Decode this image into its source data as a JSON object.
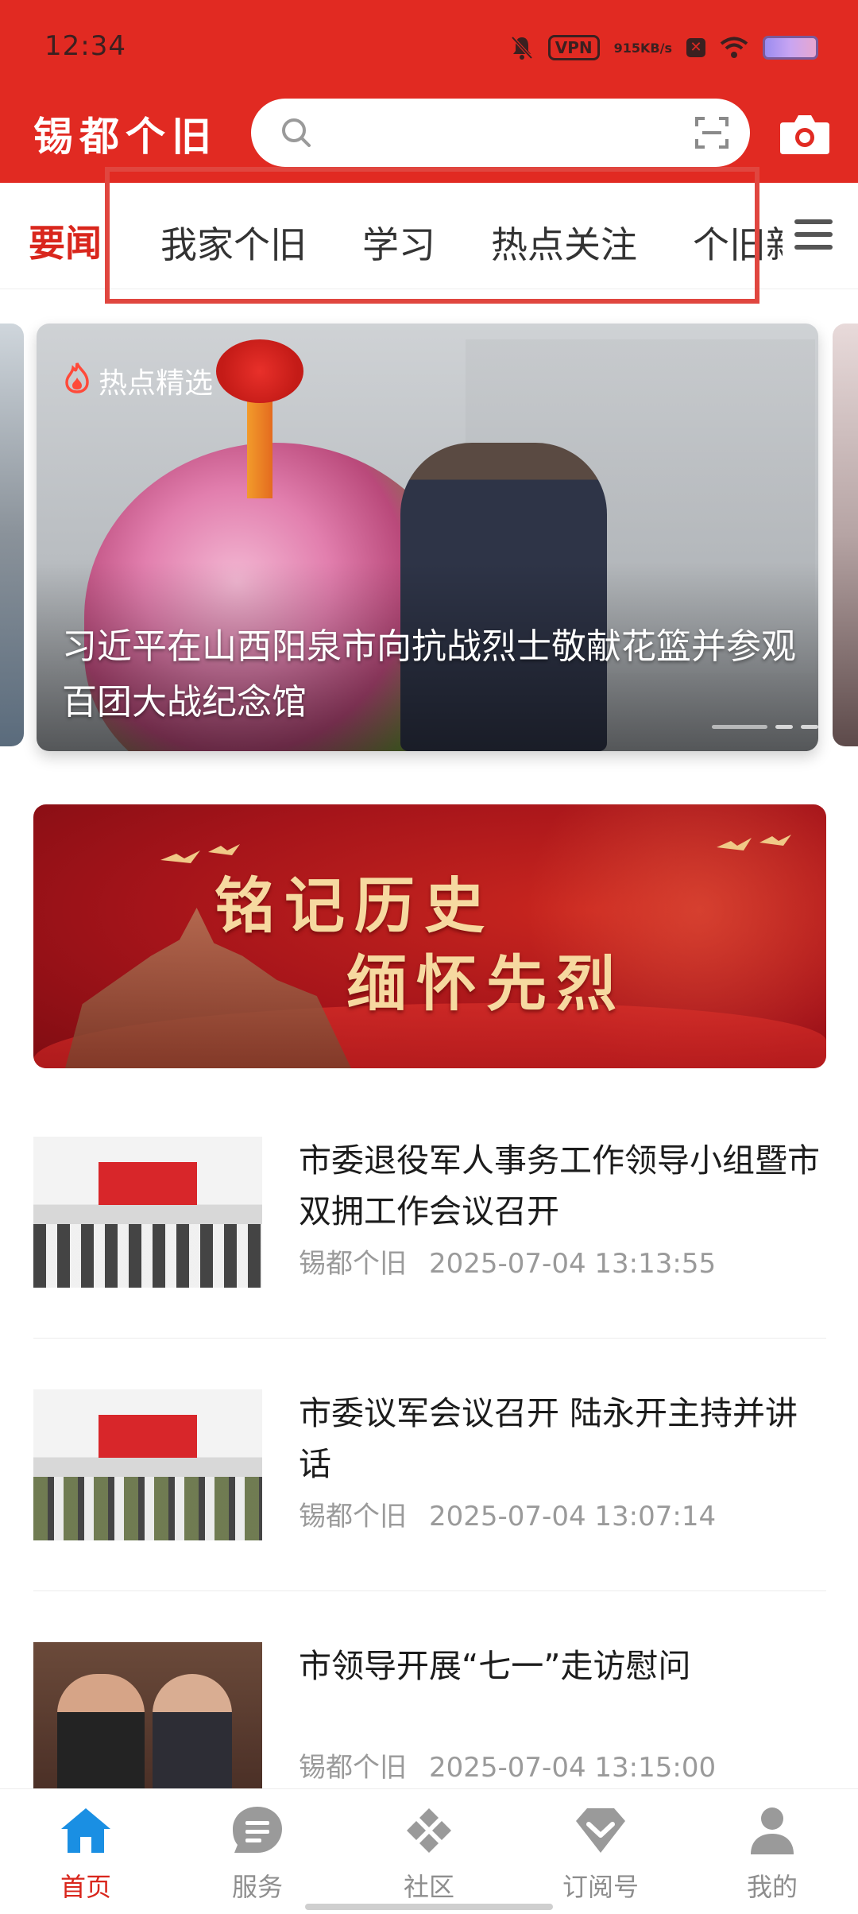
{
  "status_bar": {
    "time": "12:34",
    "vpn_label": "VPN",
    "speed_value": "915",
    "speed_unit": "KB/s"
  },
  "header": {
    "logo": "锡都个旧",
    "search": {
      "placeholder": ""
    }
  },
  "tabs": {
    "active": "要闻",
    "items": [
      "我家个旧",
      "学习",
      "热点关注",
      "个旧新"
    ]
  },
  "carousel": {
    "tag": "热点精选",
    "title": "习近平在山西阳泉市向抗战烈士敬献花篮并参观百团大战纪念馆"
  },
  "banner": {
    "line1": "铭记历史",
    "line2": "缅怀先烈"
  },
  "news": [
    {
      "title": "市委退役军人事务工作领导小组暨市双拥工作会议召开",
      "source": "锡都个旧",
      "time": "2025-07-04 13:13:55"
    },
    {
      "title": "市委议军会议召开 陆永开主持并讲话",
      "source": "锡都个旧",
      "time": "2025-07-04 13:07:14"
    },
    {
      "title": "市领导开展“七一”走访慰问",
      "source": "锡都个旧",
      "time": "2025-07-04 13:15:00"
    }
  ],
  "bottom_nav": [
    {
      "label": "首页",
      "icon": "home-icon",
      "active": true
    },
    {
      "label": "服务",
      "icon": "service-icon",
      "active": false
    },
    {
      "label": "社区",
      "icon": "community-icon",
      "active": false
    },
    {
      "label": "订阅号",
      "icon": "subscription-icon",
      "active": false
    },
    {
      "label": "我的",
      "icon": "profile-icon",
      "active": false
    }
  ],
  "colors": {
    "brand_red": "#e12a22",
    "active_red": "#d9261c",
    "text_dark": "#1c1c1c",
    "text_muted": "#9a9a9a"
  }
}
